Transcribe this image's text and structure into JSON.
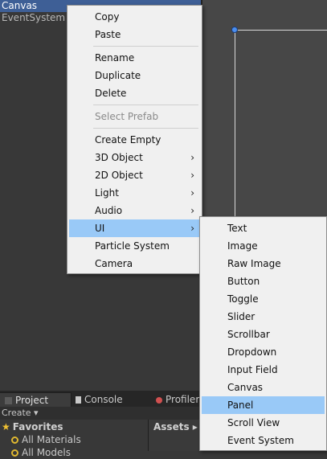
{
  "hierarchy": {
    "items": [
      {
        "label": "Canvas",
        "selected": true
      },
      {
        "label": "EventSystem",
        "selected": false
      }
    ]
  },
  "context_menu": {
    "items": {
      "copy": "Copy",
      "paste": "Paste",
      "rename": "Rename",
      "duplicate": "Duplicate",
      "delete": "Delete",
      "select_prefab": "Select Prefab",
      "create_empty": "Create Empty",
      "object_3d": "3D Object",
      "object_2d": "2D Object",
      "light": "Light",
      "audio": "Audio",
      "ui": "UI",
      "particle_system": "Particle System",
      "camera": "Camera"
    },
    "submenu_arrow": "›",
    "highlighted": "UI",
    "disabled": [
      "Select Prefab"
    ]
  },
  "ui_submenu": {
    "items": [
      "Text",
      "Image",
      "Raw Image",
      "Button",
      "Toggle",
      "Slider",
      "Scrollbar",
      "Dropdown",
      "Input Field",
      "Canvas",
      "Panel",
      "Scroll View",
      "Event System"
    ],
    "highlighted": "Panel"
  },
  "bottom_tabs": {
    "project": "Project",
    "console": "Console",
    "profiler": "Profiler",
    "active": "Project"
  },
  "project": {
    "create_label": "Create ▾",
    "favorites_label": "Favorites",
    "favorites": [
      "All Materials",
      "All Models"
    ],
    "assets_label": "Assets ▸"
  },
  "colors": {
    "selection_blue": "#3e5f96",
    "menu_highlight": "#99c9f7",
    "menu_background": "#f0f0f0",
    "canvas_handle": "#4a8ef0"
  },
  "icons": [
    "magnifier-icon",
    "star-icon",
    "chevron-right-icon",
    "project-icon",
    "console-icon",
    "profiler-icon"
  ]
}
